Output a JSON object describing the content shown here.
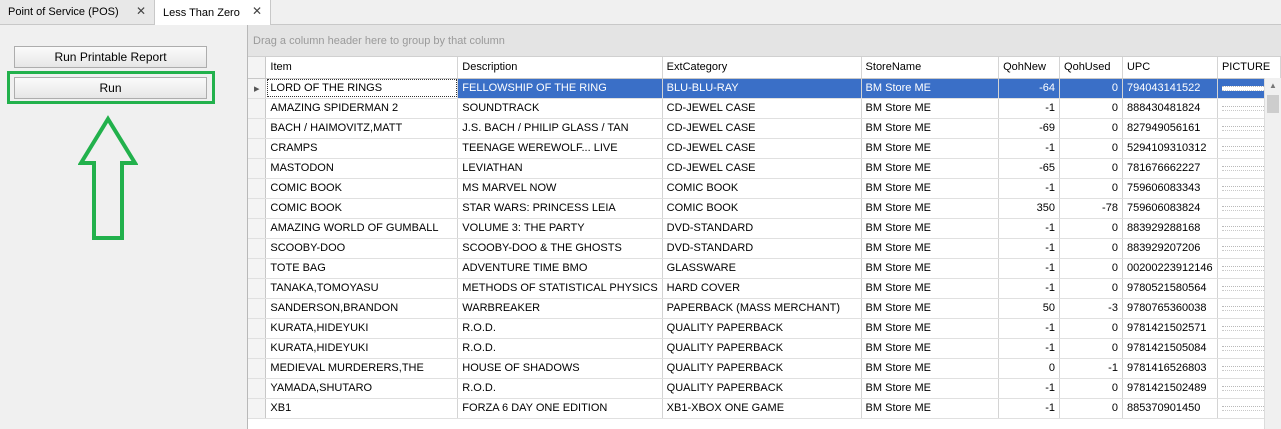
{
  "tabs": [
    {
      "label": "Point of Service (POS)",
      "close": "✕"
    },
    {
      "label": "Less Than Zero",
      "close": "✕"
    }
  ],
  "left_panel": {
    "report_button": "Run Printable Report",
    "run_button": "Run"
  },
  "annotation": {
    "color": "#22b14c"
  },
  "grid": {
    "group_hint": "Drag a column header here to group by that column",
    "columns": [
      "Item",
      "Description",
      "ExtCategory",
      "StoreName",
      "QohNew",
      "QohUsed",
      "UPC",
      "PICTURE"
    ],
    "selected_row": 0,
    "selection_color": "#3a6fc7",
    "rows": [
      {
        "item": "LORD OF THE RINGS",
        "description": "FELLOWSHIP OF THE RING",
        "category": "BLU-BLU-RAY",
        "store": "BM Store ME",
        "qoh_new": "-64",
        "qoh_used": "0",
        "upc": "794043141522"
      },
      {
        "item": "AMAZING SPIDERMAN 2",
        "description": "SOUNDTRACK",
        "category": "CD-JEWEL CASE",
        "store": "BM Store ME",
        "qoh_new": "-1",
        "qoh_used": "0",
        "upc": "888430481824"
      },
      {
        "item": "BACH / HAIMOVITZ,MATT",
        "description": "J.S. BACH / PHILIP GLASS / TAN",
        "category": "CD-JEWEL CASE",
        "store": "BM Store ME",
        "qoh_new": "-69",
        "qoh_used": "0",
        "upc": "827949056161"
      },
      {
        "item": "CRAMPS",
        "description": "TEENAGE WEREWOLF... LIVE",
        "category": "CD-JEWEL CASE",
        "store": "BM Store ME",
        "qoh_new": "-1",
        "qoh_used": "0",
        "upc": "5294109310312"
      },
      {
        "item": "MASTODON",
        "description": "LEVIATHAN",
        "category": "CD-JEWEL CASE",
        "store": "BM Store ME",
        "qoh_new": "-65",
        "qoh_used": "0",
        "upc": "781676662227"
      },
      {
        "item": "COMIC BOOK",
        "description": "MS MARVEL NOW",
        "category": "COMIC BOOK",
        "store": "BM Store ME",
        "qoh_new": "-1",
        "qoh_used": "0",
        "upc": "759606083343"
      },
      {
        "item": "COMIC BOOK",
        "description": "STAR WARS: PRINCESS LEIA",
        "category": "COMIC BOOK",
        "store": "BM Store ME",
        "qoh_new": "350",
        "qoh_used": "-78",
        "upc": "759606083824"
      },
      {
        "item": "AMAZING WORLD OF GUMBALL",
        "description": "VOLUME 3: THE PARTY",
        "category": "DVD-STANDARD",
        "store": "BM Store ME",
        "qoh_new": "-1",
        "qoh_used": "0",
        "upc": "883929288168"
      },
      {
        "item": "SCOOBY-DOO",
        "description": "SCOOBY-DOO & THE GHOSTS",
        "category": "DVD-STANDARD",
        "store": "BM Store ME",
        "qoh_new": "-1",
        "qoh_used": "0",
        "upc": "883929207206"
      },
      {
        "item": "TOTE BAG",
        "description": "ADVENTURE TIME BMO",
        "category": "GLASSWARE",
        "store": "BM Store ME",
        "qoh_new": "-1",
        "qoh_used": "0",
        "upc": "00200223912146"
      },
      {
        "item": "TANAKA,TOMOYASU",
        "description": "METHODS OF STATISTICAL PHYSICS",
        "category": "HARD COVER",
        "store": "BM Store ME",
        "qoh_new": "-1",
        "qoh_used": "0",
        "upc": "9780521580564"
      },
      {
        "item": "SANDERSON,BRANDON",
        "description": "WARBREAKER",
        "category": "PAPERBACK (MASS MERCHANT)",
        "store": "BM Store ME",
        "qoh_new": "50",
        "qoh_used": "-3",
        "upc": "9780765360038"
      },
      {
        "item": "KURATA,HIDEYUKI",
        "description": "R.O.D.",
        "category": "QUALITY PAPERBACK",
        "store": "BM Store ME",
        "qoh_new": "-1",
        "qoh_used": "0",
        "upc": "9781421502571"
      },
      {
        "item": "KURATA,HIDEYUKI",
        "description": "R.O.D.",
        "category": "QUALITY PAPERBACK",
        "store": "BM Store ME",
        "qoh_new": "-1",
        "qoh_used": "0",
        "upc": "9781421505084"
      },
      {
        "item": "MEDIEVAL MURDERERS,THE",
        "description": "HOUSE OF SHADOWS",
        "category": "QUALITY PAPERBACK",
        "store": "BM Store ME",
        "qoh_new": "0",
        "qoh_used": "-1",
        "upc": "9781416526803"
      },
      {
        "item": "YAMADA,SHUTARO",
        "description": "R.O.D.",
        "category": "QUALITY PAPERBACK",
        "store": "BM Store ME",
        "qoh_new": "-1",
        "qoh_used": "0",
        "upc": "9781421502489"
      },
      {
        "item": "XB1",
        "description": "FORZA 6 DAY ONE EDITION",
        "category": "XB1-XBOX ONE GAME",
        "store": "BM Store ME",
        "qoh_new": "-1",
        "qoh_used": "0",
        "upc": "885370901450"
      }
    ]
  }
}
